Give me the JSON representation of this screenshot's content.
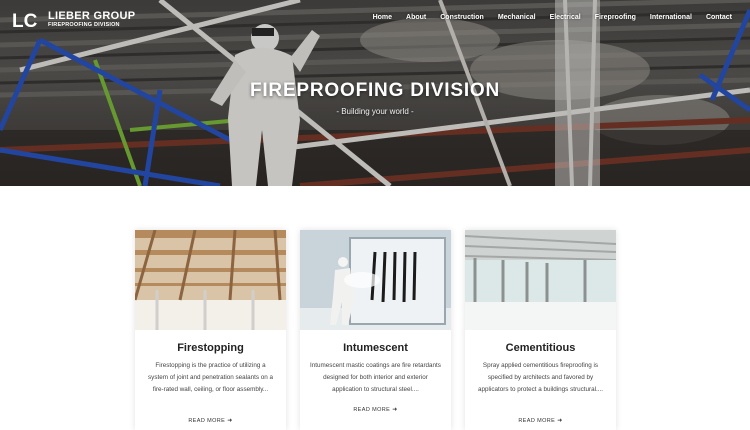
{
  "brand": {
    "logo_mark": "LC",
    "name": "LIEBER GROUP",
    "division": "FIREPROOFING DIVISION"
  },
  "nav": [
    {
      "label": "Home"
    },
    {
      "label": "About"
    },
    {
      "label": "Construction"
    },
    {
      "label": "Mechanical"
    },
    {
      "label": "Electrical"
    },
    {
      "label": "Fireproofing"
    },
    {
      "label": "International"
    },
    {
      "label": "Contact"
    }
  ],
  "hero": {
    "title": "FIREPROOFING DIVISION",
    "tagline": "- Building your world -"
  },
  "cards": [
    {
      "title": "Firestopping",
      "text": "Firestopping is the practice of utilizing a system of joint and penetration sealants on a fire-rated wall, ceiling, or floor assembly...",
      "link": "READ MORE",
      "link_icon": "arrow-right-icon"
    },
    {
      "title": "Intumescent",
      "text": "Intumescent mastic coatings are fire retardants designed for both interior and exterior application to structural steel....",
      "link": "READ MORE",
      "link_icon": "arrow-right-icon"
    },
    {
      "title": "Cementitious",
      "text": "Spray applied cementitious fireproofing is specified by architects and favored by applicators to protect a buildings structural....",
      "link": "READ MORE",
      "link_icon": "arrow-right-icon"
    }
  ]
}
